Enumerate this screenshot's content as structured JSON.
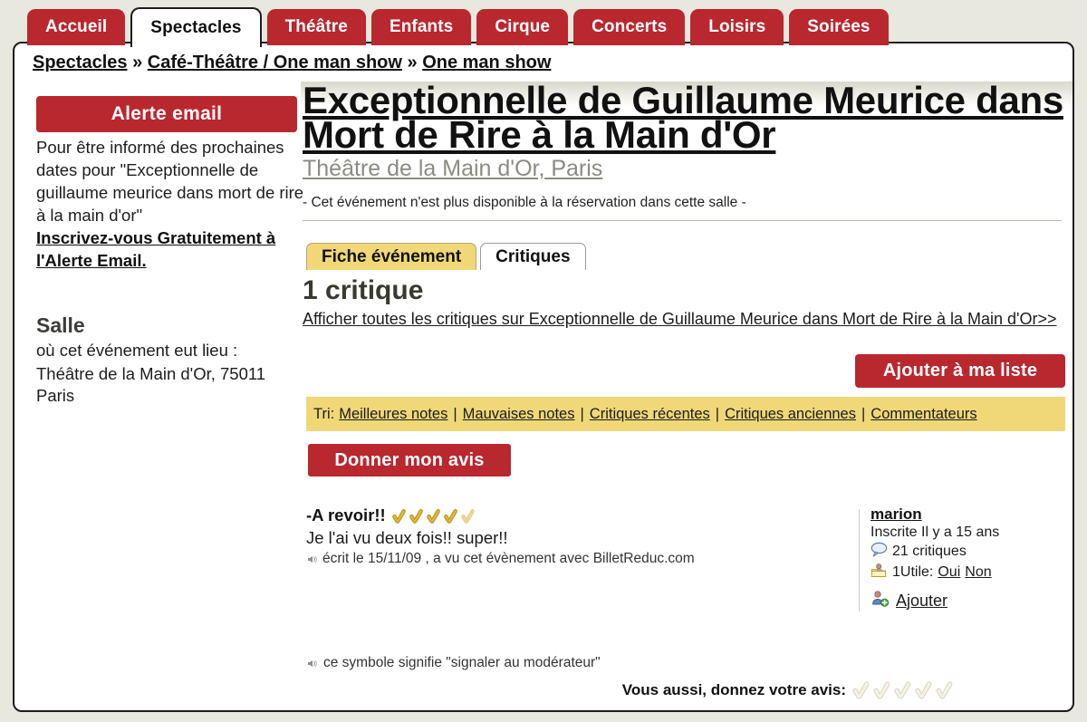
{
  "nav": {
    "tabs": [
      {
        "label": "Accueil",
        "active": false
      },
      {
        "label": "Spectacles",
        "active": true
      },
      {
        "label": "Théâtre",
        "active": false
      },
      {
        "label": "Enfants",
        "active": false
      },
      {
        "label": "Cirque",
        "active": false
      },
      {
        "label": "Concerts",
        "active": false
      },
      {
        "label": "Loisirs",
        "active": false
      },
      {
        "label": "Soirées",
        "active": false
      }
    ]
  },
  "breadcrumb": {
    "items": [
      "Spectacles",
      "Café-Théâtre / One man show",
      "One man show"
    ],
    "separator": "»"
  },
  "sidebar": {
    "alerte_button": "Alerte email",
    "alerte_text": "Pour être informé des prochaines dates pour \"Exceptionnelle de guillaume meurice dans mort de rire à la main d'or\"",
    "alerte_link": "Inscrivez-vous Gratuitement à l'Alerte Email.",
    "salle_heading": "Salle",
    "salle_subtitle": "où cet événement eut lieu :",
    "salle_address": " Théâtre de la Main d'Or, 75011 Paris"
  },
  "event": {
    "title": "Exceptionnelle de Guillaume Meurice dans Mort de Rire à la Main d'Or",
    "venue": "Théâtre de la Main d'Or, Paris",
    "notice": "- Cet événement n'est plus disponible à la réservation dans cette salle -"
  },
  "subtabs": [
    {
      "label": "Fiche événement",
      "active": false
    },
    {
      "label": "Critiques",
      "active": true
    }
  ],
  "critiques": {
    "count_label": "1 critique",
    "show_all_link": "Afficher toutes les critiques sur Exceptionnelle de Guillaume Meurice dans Mort de Rire à la Main d'Or>>",
    "add_to_list_button": "Ajouter à ma liste",
    "sort_prefix": "Tri:",
    "sort_options": [
      "Meilleures notes",
      "Mauvaises notes",
      "Critiques récentes",
      "Critiques anciennes",
      "Commentateurs"
    ],
    "sort_separator": "|",
    "give_opinion_button": "Donner mon avis"
  },
  "review": {
    "title": "-A revoir!!",
    "rating": 4.5,
    "rating_max": 5,
    "body": "Je l'ai vu deux fois!! super!!",
    "meta": "écrit le 15/11/09 , a vu cet évènement avec BilletReduc.com",
    "user": {
      "name": "marion",
      "since": "Inscrite Il y a 15 ans",
      "critiques_count": "21 critiques",
      "useful_label": "1Utile:",
      "useful_yes": "Oui",
      "useful_no": "Non",
      "add_label": "Ajouter"
    }
  },
  "footer": {
    "symbol_note": "ce symbole signifie \"signaler au modérateur\"",
    "rate_prompt": "Vous aussi, donnez votre avis:",
    "rate_value": 0,
    "rate_max": 5
  },
  "colors": {
    "brand_red": "#b9272f",
    "tab_yellow": "#f0d878",
    "page_bg": "#e9e8de",
    "panel_bg": "#ffffff",
    "gold_tick": "#e0b93a"
  },
  "icons": {
    "report": "report-icon",
    "speech_bubble": "speech-bubble-icon",
    "useful_card": "useful-card-icon",
    "add_person": "add-person-icon"
  }
}
